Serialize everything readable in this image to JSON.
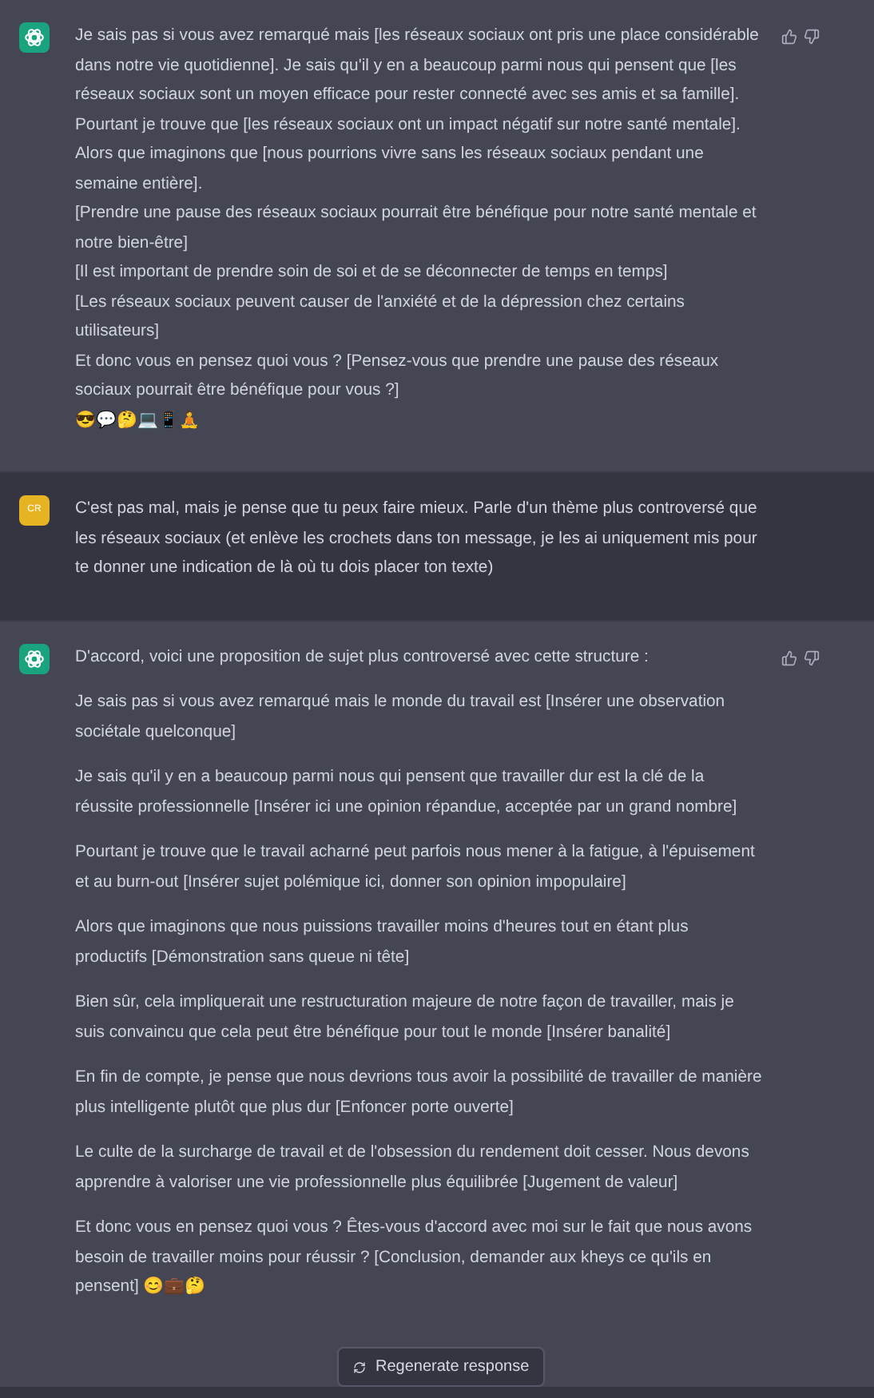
{
  "messages": [
    {
      "kind": "assistant",
      "feedback": true,
      "spaced": false,
      "paragraphs": [
        "Je sais pas si vous avez remarqué mais [les réseaux sociaux ont pris une place considérable dans notre vie quotidienne]. Je sais qu'il y en a beaucoup parmi nous qui pensent que [les réseaux sociaux sont un moyen efficace pour rester connecté avec ses amis et sa famille].",
        "Pourtant je trouve que [les réseaux sociaux ont un impact négatif sur notre santé mentale].",
        "Alors que imaginons que [nous pourrions vivre sans les réseaux sociaux pendant une semaine entière].",
        "[Prendre une pause des réseaux sociaux pourrait être bénéfique pour notre santé mentale et notre bien-être]",
        "[Il est important de prendre soin de soi et de se déconnecter de temps en temps]",
        "[Les réseaux sociaux peuvent causer de l'anxiété et de la dépression chez certains utilisateurs]",
        "Et donc vous en pensez quoi vous ? [Pensez-vous que prendre une pause des réseaux sociaux pourrait être bénéfique pour vous ?]",
        "😎💬🤔💻📱🧘"
      ]
    },
    {
      "kind": "user",
      "initials": "CR",
      "feedback": false,
      "paragraphs": [
        "C'est pas mal, mais je pense que tu peux faire mieux. Parle d'un thème plus controversé que les réseaux sociaux (et enlève les crochets dans ton message, je les ai uniquement mis pour te donner une indication de là où tu dois placer ton texte)"
      ]
    },
    {
      "kind": "assistant",
      "feedback": true,
      "spaced": true,
      "paragraphs": [
        "D'accord, voici une proposition de sujet plus controversé avec cette structure :",
        "Je sais pas si vous avez remarqué mais le monde du travail est [Insérer une observation sociétale quelconque]",
        "Je sais qu'il y en a beaucoup parmi nous qui pensent que travailler dur est la clé de la réussite professionnelle [Insérer ici une opinion répandue, acceptée par un grand nombre]",
        "Pourtant je trouve que le travail acharné peut parfois nous mener à la fatigue, à l'épuisement et au burn-out [Insérer sujet polémique ici, donner son opinion impopulaire]",
        "Alors que imaginons que nous puissions travailler moins d'heures tout en étant plus productifs [Démonstration sans queue ni tête]",
        "Bien sûr, cela impliquerait une restructuration majeure de notre façon de travailler, mais je suis convaincu que cela peut être bénéfique pour tout le monde [Insérer banalité]",
        "En fin de compte, je pense que nous devrions tous avoir la possibilité de travailler de manière plus intelligente plutôt que plus dur [Enfoncer porte ouverte]",
        "Le culte de la surcharge de travail et de l'obsession du rendement doit cesser. Nous devons apprendre à valoriser une vie professionnelle plus équilibrée [Jugement de valeur]",
        "Et donc vous en pensez quoi vous ? Êtes-vous d'accord avec moi sur le fait que nous avons besoin de travailler moins pour réussir ? [Conclusion, demander aux kheys ce qu'ils en pensent] 😊💼🤔"
      ]
    }
  ],
  "regenerate_button": "Regenerate response"
}
